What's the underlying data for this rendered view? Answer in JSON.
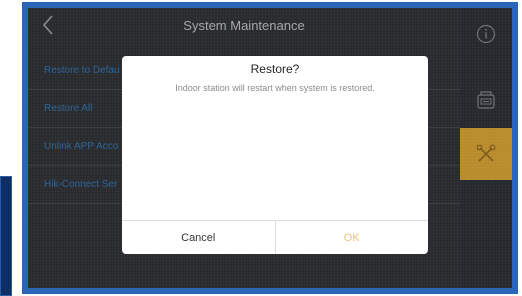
{
  "header": {
    "title": "System Maintenance",
    "back_icon": "chevron-left-icon"
  },
  "menu": {
    "items": [
      {
        "label": "Restore to Defau"
      },
      {
        "label": "Restore All"
      },
      {
        "label": "Unlink APP Acco"
      },
      {
        "label": "Hik-Connect Ser"
      }
    ]
  },
  "sidebar": {
    "items": [
      {
        "icon": "info-icon",
        "active": false
      },
      {
        "icon": "intercom-icon",
        "active": false
      },
      {
        "icon": "tools-icon",
        "active": true
      }
    ]
  },
  "dialog": {
    "title": "Restore?",
    "message": "Indoor station will restart when system is restored.",
    "cancel_label": "Cancel",
    "ok_label": "OK"
  },
  "colors": {
    "accent": "#b98b2a",
    "link_blue": "#3f8fdc",
    "ok_text": "#e6c27a",
    "frame_blue": "#2a66b8"
  }
}
